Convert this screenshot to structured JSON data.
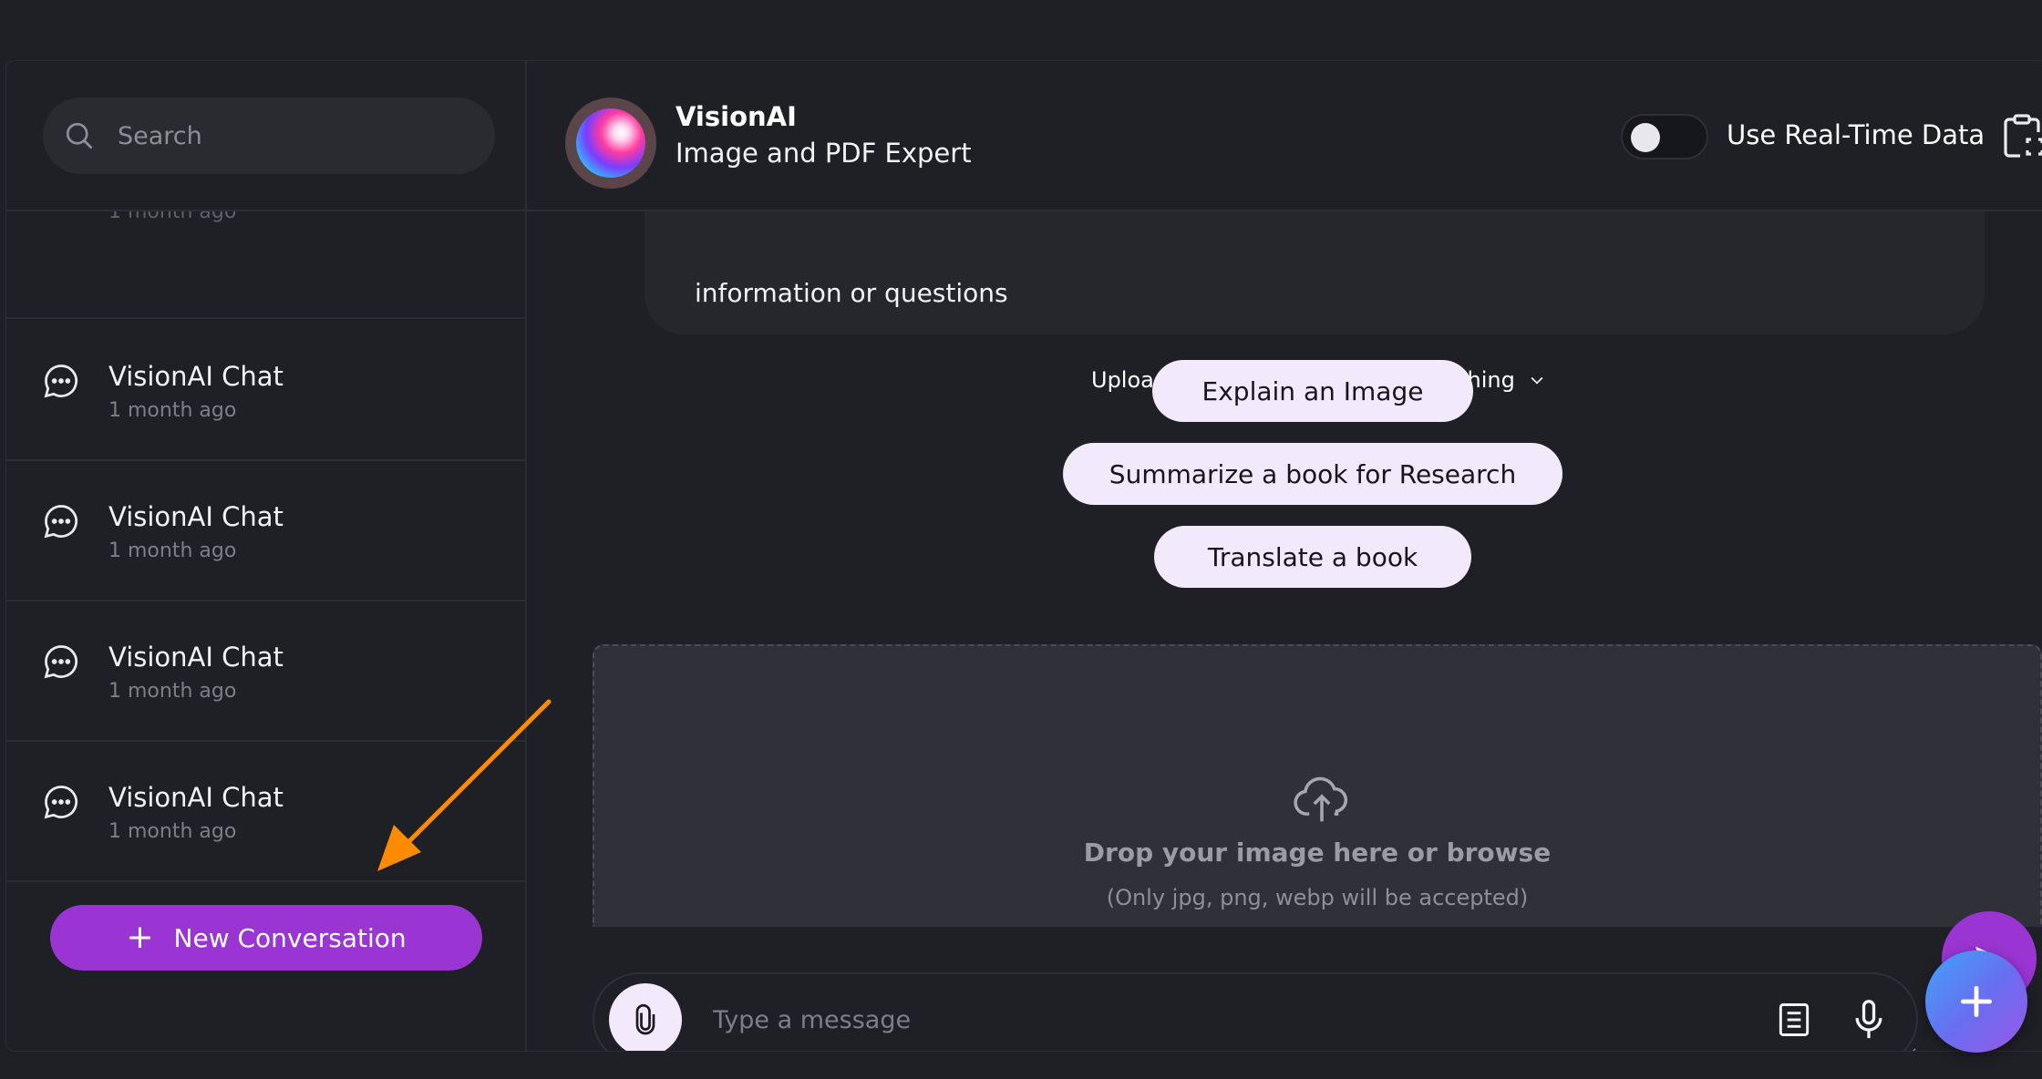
{
  "sidebar": {
    "search_placeholder": "Search",
    "partial_time": "1 month ago",
    "conversations": [
      {
        "title": "VisionAI Chat",
        "time": "1 month ago"
      },
      {
        "title": "VisionAI Chat",
        "time": "1 month ago"
      },
      {
        "title": "VisionAI Chat",
        "time": "1 month ago"
      },
      {
        "title": "VisionAI Chat",
        "time": "1 month ago"
      }
    ],
    "new_conversation_label": "New Conversation"
  },
  "header": {
    "bot_name": "VisionAI",
    "bot_description": "Image and PDF Expert",
    "realtime_label": "Use Real-Time Data",
    "realtime_enabled": false
  },
  "chat": {
    "bubble_text": "information or questions",
    "suggestions_heading": "Upload an image and ask me anything",
    "suggestions": [
      "Explain an Image",
      "Summarize a book for Research",
      "Translate a book"
    ]
  },
  "dropzone": {
    "title": "Drop your image here or browse",
    "subtitle": "(Only jpg, png, webp will be accepted)"
  },
  "composer": {
    "placeholder": "Type a message"
  },
  "annotation": {
    "arrow_color": "#ff8c00"
  },
  "colors": {
    "accent": "#9a35d3",
    "background": "#1f2026",
    "pill": "#f3e9fc"
  }
}
